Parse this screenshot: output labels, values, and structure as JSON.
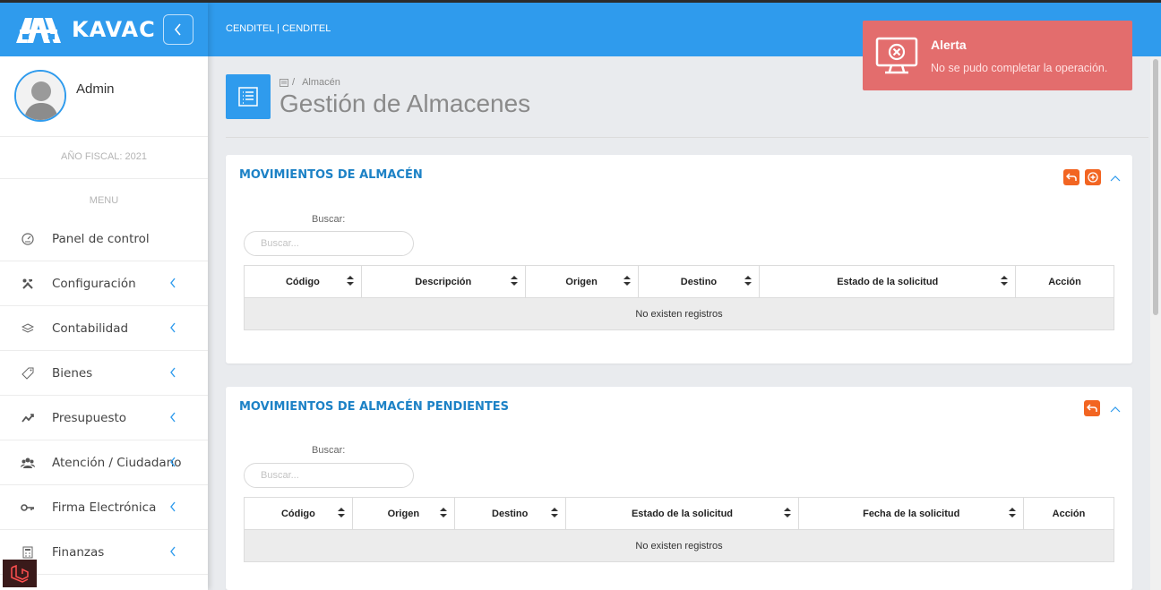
{
  "app": {
    "brand_name": "KAVAC",
    "org_label": "CENDITEL | CENDITEL"
  },
  "user": {
    "name": "Admin",
    "fiscal_year": "AÑO FISCAL: 2021"
  },
  "sidebar": {
    "menu_title": "MENU",
    "items": [
      {
        "label": "Panel de control",
        "icon": "dashboard-icon",
        "has_submenu": false
      },
      {
        "label": "Configuración",
        "icon": "tools-icon",
        "has_submenu": true
      },
      {
        "label": "Contabilidad",
        "icon": "layers-icon",
        "has_submenu": true
      },
      {
        "label": "Bienes",
        "icon": "tag-icon",
        "has_submenu": true
      },
      {
        "label": "Presupuesto",
        "icon": "trend-icon",
        "has_submenu": true
      },
      {
        "label": "Atención / Ciudadano",
        "icon": "users-icon",
        "has_submenu": true
      },
      {
        "label": "Firma Electrónica",
        "icon": "key-icon",
        "has_submenu": true
      },
      {
        "label": "Finanzas",
        "icon": "calculator-icon",
        "has_submenu": true
      }
    ]
  },
  "page": {
    "breadcrumb": "Almacén",
    "title": "Gestión de Almacenes"
  },
  "movements_card": {
    "title": "MOVIMIENTOS DE ALMACÉN",
    "search_label": "Buscar:",
    "search_placeholder": "Buscar...",
    "columns": [
      "Código",
      "Descripción",
      "Origen",
      "Destino",
      "Estado de la solicitud",
      "Acción"
    ],
    "empty_message": "No existen registros"
  },
  "pending_card": {
    "title": "MOVIMIENTOS DE ALMACÉN PENDIENTES",
    "search_label": "Buscar:",
    "search_placeholder": "Buscar...",
    "columns": [
      "Código",
      "Origen",
      "Destino",
      "Estado de la solicitud",
      "Fecha de la solicitud",
      "Acción"
    ],
    "empty_message": "No existen registros"
  },
  "alert": {
    "title": "Alerta",
    "message": "No se pudo completar la operación."
  },
  "colors": {
    "primary": "#2f9bed",
    "accent": "#f26522",
    "alert": "#e36d6d"
  }
}
